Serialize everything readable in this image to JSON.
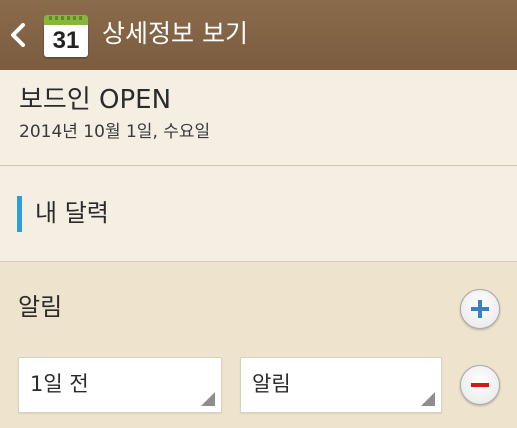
{
  "header": {
    "back_icon": "chevron-left-icon",
    "calendar_icon": "calendar-icon",
    "calendar_icon_day": "31",
    "title": "상세정보 보기"
  },
  "event": {
    "title": "보드인 OPEN",
    "date": "2014년 10월 1일, 수요일"
  },
  "calendar": {
    "name": "내 달력",
    "color": "#2c9fd8"
  },
  "alarm": {
    "title": "알림",
    "add_icon": "plus-circle-icon",
    "remove_icon": "minus-circle-icon",
    "time_value": "1일 전",
    "type_value": "알림"
  },
  "colors": {
    "header_bg": "#7b5c3e",
    "accent_plus": "#3b7fc4",
    "accent_minus": "#d11a1a"
  }
}
